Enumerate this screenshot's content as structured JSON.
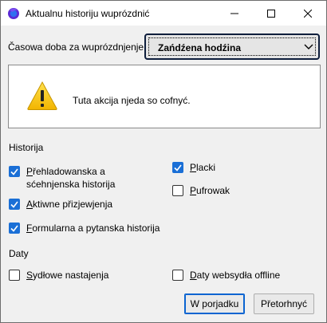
{
  "window": {
    "title": "Aktualnu historiju wuprózdnić"
  },
  "time_range": {
    "label": "Časowa doba za wuprózdnjenje",
    "label_underline_char": "Č",
    "selected": "Zańdźena hodźina"
  },
  "warning": {
    "message": "Tuta akcija njeda so cofnyć."
  },
  "history": {
    "heading": "Historija",
    "items": [
      {
        "label_first": "P",
        "label_rest": "řehladowanska a sćehnjenska historija",
        "checked": true
      },
      {
        "label_first": "A",
        "label_rest": "ktiwne přizjewjenja",
        "checked": true
      },
      {
        "label_first": "F",
        "label_rest": "ormularna a pytanska historija",
        "checked": true
      },
      {
        "label_first": "P",
        "label_rest": "lacki",
        "checked": true
      },
      {
        "label_first": "P",
        "label_rest": "ufrowak",
        "checked": false
      }
    ]
  },
  "data": {
    "heading": "Daty",
    "items": [
      {
        "label_first": "S",
        "label_rest": "ydłowe nastajenja",
        "checked": false
      },
      {
        "label_first": "D",
        "label_rest": "aty websydła offline",
        "checked": false
      }
    ]
  },
  "buttons": {
    "ok": "W porjadku",
    "cancel": "Přetorhnyć"
  },
  "colors": {
    "accent": "#1a6fd6",
    "window_bg": "#f0f0f0"
  }
}
